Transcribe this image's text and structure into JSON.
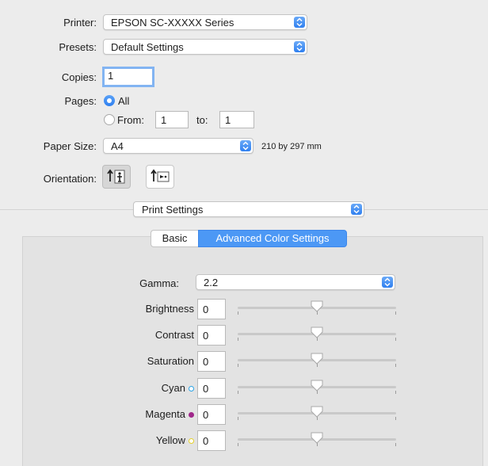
{
  "printer": {
    "label": "Printer:",
    "value": "EPSON SC-XXXXX Series"
  },
  "presets": {
    "label": "Presets:",
    "value": "Default Settings"
  },
  "copies": {
    "label": "Copies:",
    "value": "1"
  },
  "pages": {
    "label": "Pages:",
    "all_label": "All",
    "from_label": "From:",
    "from_value": "1",
    "to_label": "to:",
    "to_value": "1",
    "selected": "All"
  },
  "paper_size": {
    "label": "Paper Size:",
    "value": "A4",
    "dimensions": "210 by 297 mm"
  },
  "orientation": {
    "label": "Orientation:",
    "selected": "portrait"
  },
  "section_popup": {
    "value": "Print Settings"
  },
  "tabs": [
    {
      "label": "Basic",
      "active": false
    },
    {
      "label": "Advanced Color Settings",
      "active": true
    }
  ],
  "gamma": {
    "label": "Gamma:",
    "value": "2.2"
  },
  "adjustments": [
    {
      "label": "Brightness",
      "value": "0",
      "dot": null,
      "level": 0.5
    },
    {
      "label": "Contrast",
      "value": "0",
      "dot": null,
      "level": 0.5
    },
    {
      "label": "Saturation",
      "value": "0",
      "dot": null,
      "level": 0.5
    },
    {
      "label": "Cyan",
      "value": "0",
      "dot": "#2aa3e6",
      "level": 0.5
    },
    {
      "label": "Magenta",
      "value": "0",
      "dot": "#a0278a",
      "level": 0.5
    },
    {
      "label": "Yellow",
      "value": "0",
      "dot": "#e5d12b",
      "level": 0.5
    }
  ],
  "colors": {
    "accent": "#4c98f5"
  }
}
